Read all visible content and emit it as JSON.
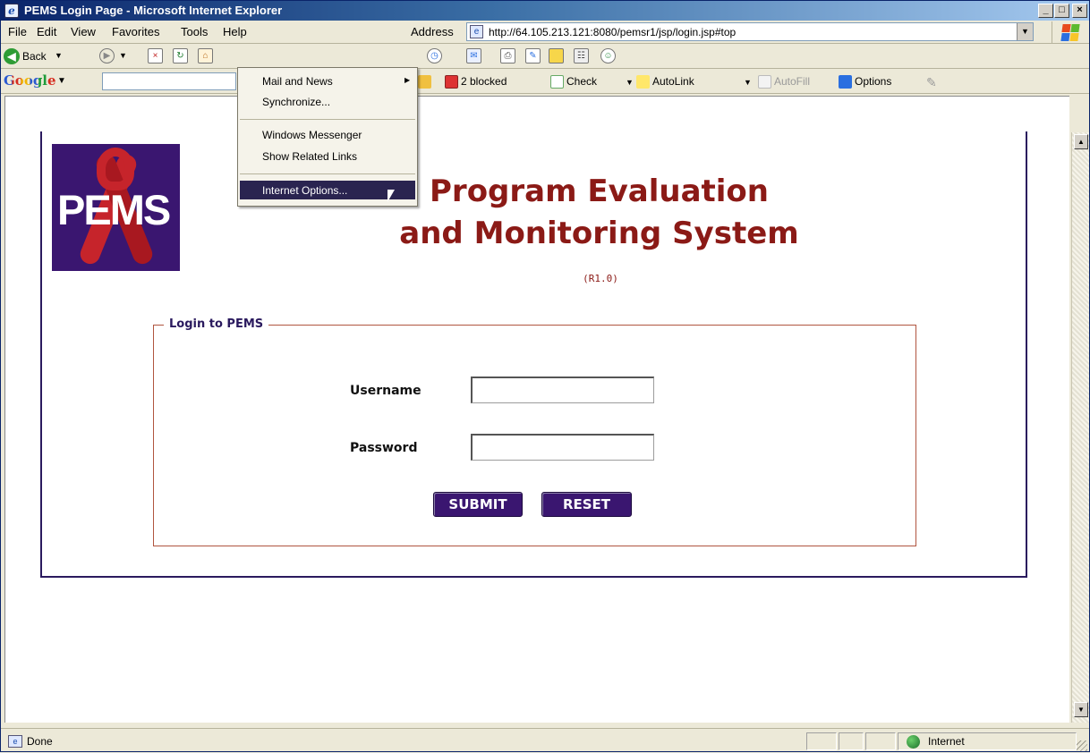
{
  "window": {
    "title": "PEMS Login Page - Microsoft Internet Explorer",
    "min_glyph": "_",
    "max_glyph": "□",
    "close_glyph": "×"
  },
  "menubar": {
    "items": [
      {
        "label": "File"
      },
      {
        "label": "Edit"
      },
      {
        "label": "View"
      },
      {
        "label": "Favorites"
      },
      {
        "label": "Tools"
      },
      {
        "label": "Help"
      }
    ],
    "address_label": "Address",
    "address_url": "http://64.105.213.121:8080/pemsr1/jsp/login.jsp#top"
  },
  "toolbar": {
    "back_label": "Back"
  },
  "googlebar": {
    "logo": "Google",
    "blocked_label": "2 blocked",
    "check_label": "Check",
    "autolink_label": "AutoLink",
    "autofill_label": "AutoFill",
    "options_label": "Options"
  },
  "tools_menu": {
    "items": [
      {
        "label": "Mail and News",
        "has_submenu": true
      },
      {
        "label": "Synchronize..."
      },
      {
        "label": "Windows Messenger"
      },
      {
        "label": "Show Related Links"
      },
      {
        "label": "Internet Options...",
        "highlighted": true
      }
    ]
  },
  "page": {
    "logo_text": "PEMS",
    "title_line1": "Program Evaluation",
    "title_line2": "and Monitoring System",
    "version": "(R1.0)",
    "login_legend": "Login to PEMS",
    "username_label": "Username",
    "username_value": "",
    "password_label": "Password",
    "password_value": "",
    "submit_label": "SUBMIT",
    "reset_label": "RESET"
  },
  "statusbar": {
    "status": "Done",
    "zone": "Internet"
  },
  "colors": {
    "brand_purple": "#3a1670",
    "title_red": "#8b1a16",
    "fieldset_border": "#b0553f",
    "menu_highlight": "#2a2450"
  }
}
